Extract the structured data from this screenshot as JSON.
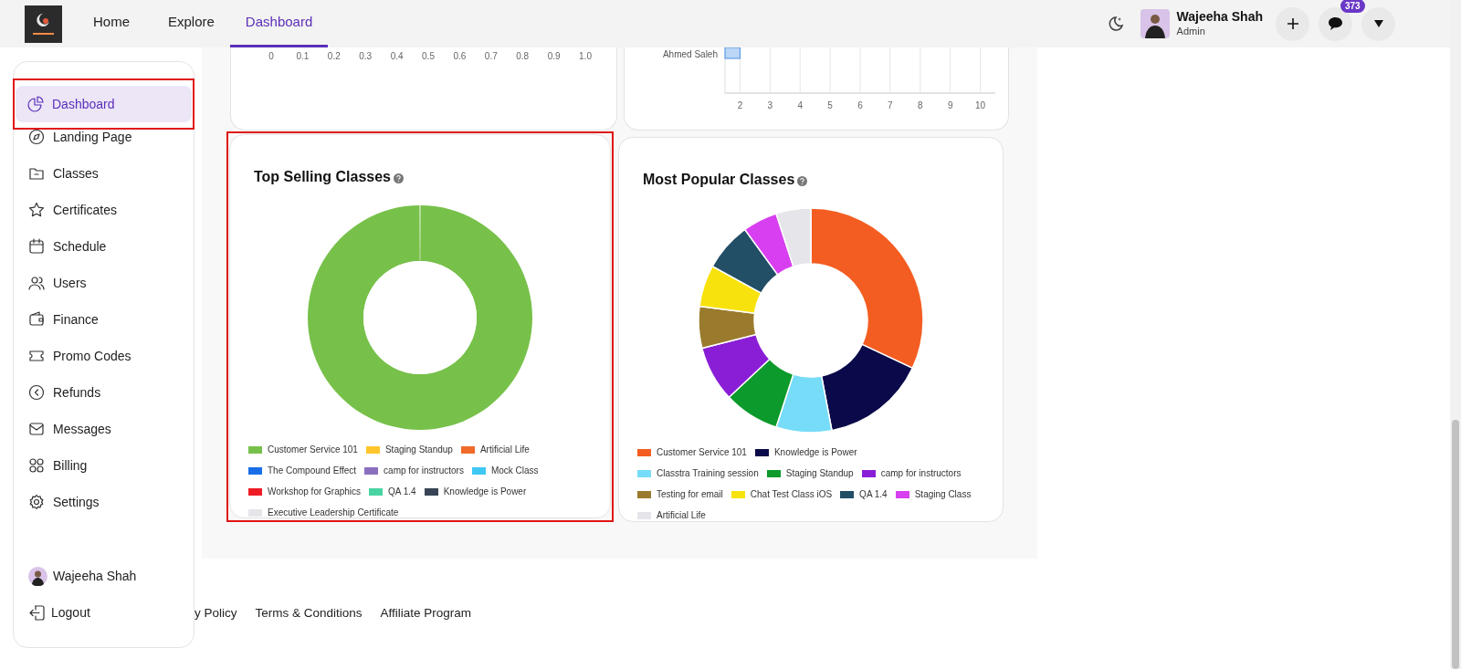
{
  "nav": {
    "tabs": [
      {
        "label": "Home",
        "selected": false
      },
      {
        "label": "Explore",
        "selected": false
      },
      {
        "label": "Dashboard",
        "selected": true
      }
    ],
    "user": {
      "name": "Wajeeha Shah",
      "role": "Admin"
    },
    "messages_badge": "373"
  },
  "sidebar": {
    "items": [
      {
        "label": "Dashboard",
        "selected": true,
        "highlighted": true
      },
      {
        "label": "Landing Page",
        "selected": false,
        "highlighted": false
      },
      {
        "label": "Classes",
        "selected": false,
        "highlighted": false
      },
      {
        "label": "Certificates",
        "selected": false,
        "highlighted": false
      },
      {
        "label": "Schedule",
        "selected": false,
        "highlighted": false
      },
      {
        "label": "Users",
        "selected": false,
        "highlighted": false
      },
      {
        "label": "Finance",
        "selected": false,
        "highlighted": false
      },
      {
        "label": "Promo Codes",
        "selected": false,
        "highlighted": false
      },
      {
        "label": "Refunds",
        "selected": false,
        "highlighted": false
      },
      {
        "label": "Messages",
        "selected": false,
        "highlighted": false
      },
      {
        "label": "Billing",
        "selected": false,
        "highlighted": false
      },
      {
        "label": "Settings",
        "selected": false,
        "highlighted": false
      }
    ],
    "user": "Wajeeha Shah",
    "logout": "Logout"
  },
  "top_cards": [
    {
      "axis_ticks": [
        "0",
        "0.1",
        "0.2",
        "0.3",
        "0.4",
        "0.5",
        "0.6",
        "0.7",
        "0.8",
        "0.9",
        "1.0"
      ]
    },
    {
      "chart_data": {
        "type": "bar",
        "orientation": "horizontal",
        "grid": true,
        "categories": [
          "Ahmed Saleh"
        ],
        "values": [
          2
        ],
        "xlim": [
          1.5,
          10.5
        ],
        "xticks": [
          2,
          3,
          4,
          5,
          6,
          7,
          8,
          9,
          10
        ]
      }
    }
  ],
  "cards": [
    {
      "highlighted": true,
      "chart_data": {
        "type": "donut",
        "title": "Top Selling Classes",
        "categories": [
          "Customer Service 101",
          "Staging Standup",
          "Artificial Life",
          "The Compound Effect",
          "camp for instructors",
          "Mock Class",
          "Workshop for Graphics",
          "QA 1.4",
          "Knowledge is Power",
          "Executive Leadership Certificate"
        ],
        "values": [
          100,
          0,
          0,
          0,
          0,
          0,
          0,
          0,
          0,
          0
        ],
        "colors": [
          "#77c14a",
          "#ffc62b",
          "#f06a2a",
          "#1a6ee8",
          "#8a6fbf",
          "#3fc8f4",
          "#ee1c25",
          "#49d3a1",
          "#384456",
          "#e6e6ea"
        ]
      }
    },
    {
      "highlighted": false,
      "chart_data": {
        "type": "donut",
        "title": "Most Popular Classes",
        "categories": [
          "Customer Service 101",
          "Knowledge is Power",
          "Classtra Training session",
          "Staging Standup",
          "camp for instructors",
          "Testing for email",
          "Chat Test Class iOS",
          "QA 1.4",
          "Staging Class",
          "Artificial Life"
        ],
        "values": [
          32,
          15,
          8,
          8,
          8,
          6,
          6,
          7,
          5,
          5
        ],
        "colors": [
          "#f45d22",
          "#0a0a4a",
          "#76dcf8",
          "#0b9a2b",
          "#8a1ed6",
          "#9a7b2e",
          "#f8e20e",
          "#224e66",
          "#d83ff0",
          "#e6e6ea"
        ]
      }
    }
  ],
  "footer_links": [
    "y Policy",
    "Terms & Conditions",
    "Affiliate Program"
  ]
}
